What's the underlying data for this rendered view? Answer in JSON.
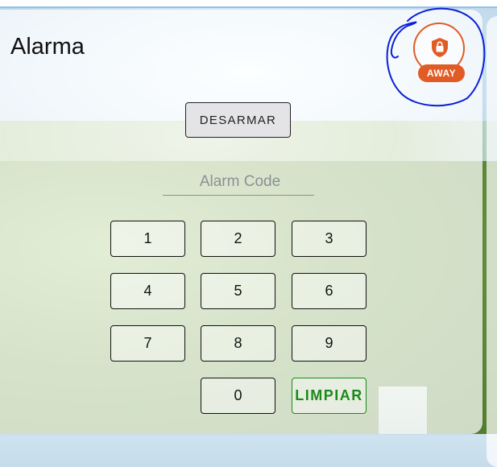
{
  "panel": {
    "title": "Alarma"
  },
  "status": {
    "badge": "AWAY",
    "icon": "lock-shield-icon",
    "color": "#e15b25"
  },
  "actions": {
    "disarm_label": "DESARMAR"
  },
  "code": {
    "placeholder": "Alarm Code",
    "value": ""
  },
  "keypad": {
    "keys": [
      "1",
      "2",
      "3",
      "4",
      "5",
      "6",
      "7",
      "8",
      "9",
      "0"
    ],
    "clear_label": "LIMPIAR",
    "clear_color": "#1b8a1b"
  }
}
